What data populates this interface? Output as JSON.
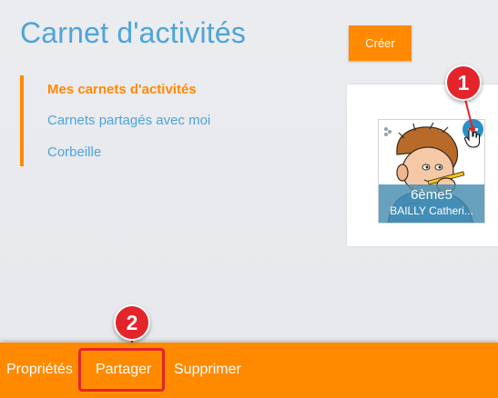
{
  "page": {
    "title": "Carnet d'activités",
    "create_label": "Créer"
  },
  "nav": {
    "items": [
      {
        "label": "Mes carnets d'activités",
        "active": true
      },
      {
        "label": "Carnets partagés avec moi",
        "active": false
      },
      {
        "label": "Corbeille",
        "active": false
      }
    ]
  },
  "notebook": {
    "name": "6ème5",
    "owner": "BAILLY Catheri..."
  },
  "annotations": {
    "callout_1": "1",
    "callout_2": "2"
  },
  "action_bar": {
    "items": [
      "Propriétés",
      "Partager",
      "Supprimer"
    ]
  },
  "colors": {
    "accent": "#ff8a00",
    "link": "#4ea4d9",
    "callout": "#e4242b",
    "caption": "#468caf"
  }
}
